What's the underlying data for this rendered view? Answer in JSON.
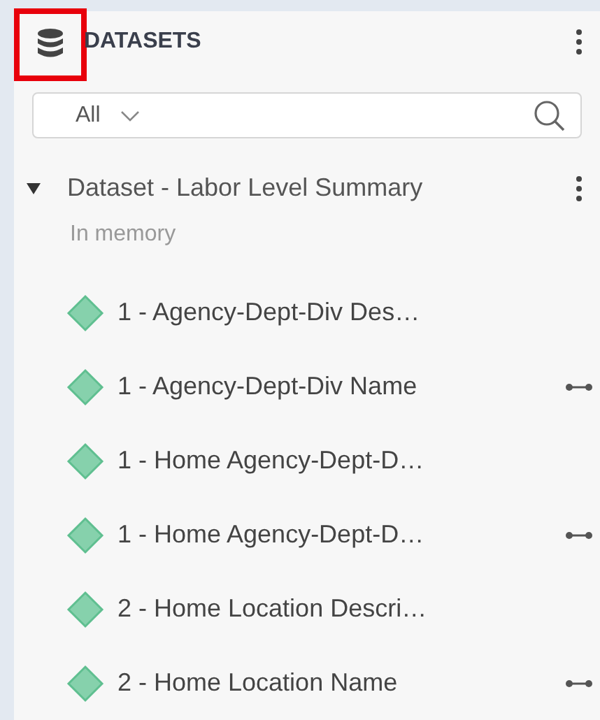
{
  "panel": {
    "title": "DATASETS"
  },
  "filter": {
    "value": "All"
  },
  "dataset": {
    "name": "Dataset - Labor Level Summary",
    "expanded": true,
    "status": "In memory",
    "fields": [
      {
        "label": "1 - Agency-Dept-Div Des…",
        "linked": false
      },
      {
        "label": "1 - Agency-Dept-Div Name",
        "linked": true
      },
      {
        "label": "1 - Home Agency-Dept-D…",
        "linked": false
      },
      {
        "label": "1 - Home Agency-Dept-D…",
        "linked": true
      },
      {
        "label": "2 - Home Location Descri…",
        "linked": false
      },
      {
        "label": "2 - Home Location Name",
        "linked": true
      }
    ]
  }
}
